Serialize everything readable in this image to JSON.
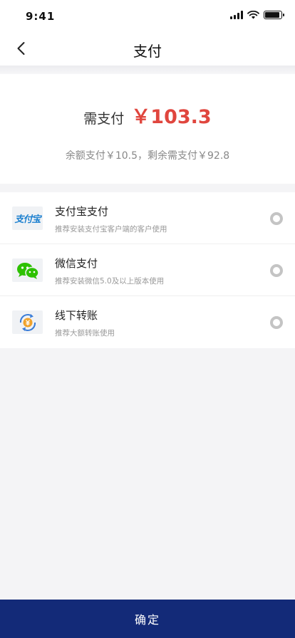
{
  "status_bar": {
    "time": "9:41"
  },
  "nav": {
    "title": "支付"
  },
  "amount": {
    "label": "需支付",
    "value": "￥103.3",
    "balance_text": "余额支付￥10.5，剩余需支付￥92.8"
  },
  "methods": [
    {
      "title": "支付宝支付",
      "desc": "推荐安装支付宝客户端的客户使用",
      "icon": "alipay-icon",
      "icon_text": "支付宝"
    },
    {
      "title": "微信支付",
      "desc": "推荐安装微信5.0及以上版本使用",
      "icon": "wechat-icon"
    },
    {
      "title": "线下转账",
      "desc": "推荐大额转账使用",
      "icon": "bank-transfer-icon"
    }
  ],
  "confirm_label": "确定",
  "colors": {
    "accent_red": "#e0463e",
    "confirm_bg": "#132a78",
    "wechat_green": "#2dc100"
  }
}
